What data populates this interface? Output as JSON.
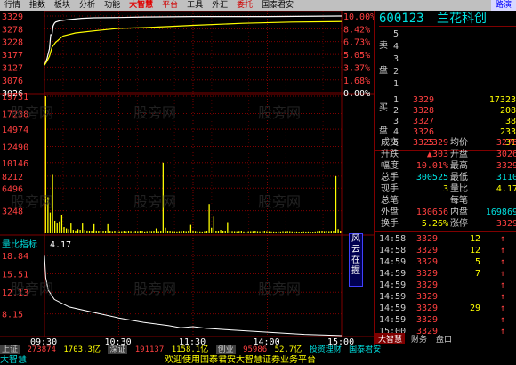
{
  "menu": {
    "items": [
      "行情",
      "指数",
      "板块",
      "分析",
      "功能",
      "大智慧",
      "平台",
      "工具",
      "外汇",
      "委托",
      "国泰君安"
    ],
    "right_button": "路演"
  },
  "chart_data": {
    "type": "line",
    "price_axis": {
      "ticks": [
        "3329",
        "3278",
        "3228",
        "3177",
        "3127",
        "3076",
        "3026"
      ],
      "prev_close": "3026",
      "ylim": [
        3026,
        3329
      ]
    },
    "pct_axis": {
      "ticks": [
        "10.00%",
        "8.42%",
        "6.73%",
        "5.05%",
        "3.37%",
        "1.68%",
        "0.00%"
      ]
    },
    "volume_axis": {
      "ticks": [
        "19731",
        "17238",
        "14974",
        "12490",
        "10146",
        "8212",
        "6496",
        "3248"
      ],
      "ylim": [
        0,
        19731
      ]
    },
    "time_axis": [
      "09:30",
      "10:30",
      "11:30",
      "14:00",
      "15:00"
    ],
    "price_series": [
      {
        "name": "price",
        "points": [
          [
            0,
            3135
          ],
          [
            2,
            3160
          ],
          [
            4,
            3200
          ],
          [
            5,
            3255
          ],
          [
            6,
            3255
          ],
          [
            7,
            3290
          ],
          [
            8,
            3300
          ],
          [
            9,
            3305
          ],
          [
            12,
            3310
          ],
          [
            15,
            3312
          ],
          [
            20,
            3315
          ],
          [
            30,
            3320
          ],
          [
            40,
            3322
          ],
          [
            60,
            3323
          ],
          [
            80,
            3325
          ],
          [
            100,
            3326
          ],
          [
            120,
            3327
          ],
          [
            180,
            3327
          ],
          [
            240,
            3329
          ]
        ]
      },
      {
        "name": "avg",
        "points": [
          [
            0,
            3135
          ],
          [
            2,
            3150
          ],
          [
            4,
            3170
          ],
          [
            6,
            3205
          ],
          [
            9,
            3225
          ],
          [
            15,
            3250
          ],
          [
            25,
            3262
          ],
          [
            40,
            3270
          ],
          [
            60,
            3280
          ],
          [
            80,
            3283
          ],
          [
            100,
            3287
          ],
          [
            120,
            3292
          ],
          [
            160,
            3300
          ],
          [
            200,
            3305
          ],
          [
            240,
            3307
          ]
        ]
      }
    ],
    "volume_bars": [
      19731,
      5200,
      3000,
      8400,
      1800,
      1400,
      1700,
      2600,
      900,
      700,
      600,
      1400,
      500,
      400,
      600,
      500,
      1400,
      500,
      400,
      350,
      300,
      1300,
      400,
      300,
      250,
      350,
      300,
      1300,
      250,
      200,
      300,
      200,
      180,
      200,
      250,
      200,
      300,
      220,
      180,
      240,
      200,
      260,
      300,
      150,
      200,
      280,
      220,
      300,
      700,
      200,
      250,
      10146,
      800,
      300,
      250,
      200,
      180,
      160,
      200,
      220,
      300,
      200,
      260,
      1200,
      300,
      220,
      180,
      160,
      140,
      200,
      260,
      4200,
      800,
      2400,
      300,
      250,
      500,
      300,
      350,
      1600,
      250,
      220,
      200,
      180,
      220,
      300,
      160,
      140,
      180,
      200,
      220,
      260,
      200,
      180,
      240,
      300,
      200,
      180,
      160,
      150,
      140,
      160,
      150,
      200,
      180,
      220,
      200,
      160,
      140,
      150,
      120,
      130,
      160,
      140,
      150,
      130,
      120,
      150,
      200,
      240,
      300,
      200,
      260,
      200,
      240,
      300,
      8212,
      600,
      300
    ],
    "indicator": {
      "name": "量比指标",
      "value": "4.17",
      "ticks": [
        "18.84",
        "15.51",
        "12.13",
        "8.15"
      ],
      "ylim": [
        4,
        20
      ],
      "points": [
        [
          0,
          18.8
        ],
        [
          1,
          14.8
        ],
        [
          3,
          12.5
        ],
        [
          8,
          10.8
        ],
        [
          20,
          9.4
        ],
        [
          40,
          8.4
        ],
        [
          60,
          7.4
        ],
        [
          80,
          6.6
        ],
        [
          100,
          6.0
        ],
        [
          110,
          5.6
        ],
        [
          120,
          5.8
        ],
        [
          130,
          5.5
        ],
        [
          150,
          5.2
        ],
        [
          180,
          4.8
        ],
        [
          210,
          4.4
        ],
        [
          240,
          4.17
        ]
      ]
    }
  },
  "sidepanel": {
    "code": "600123",
    "name": "兰花科创",
    "sell_label": "卖",
    "sell_disk": "盘",
    "buy_label": "买",
    "buy_disk": "盘",
    "sell_levels": [
      {
        "level": "5",
        "price": "",
        "qty": ""
      },
      {
        "level": "4",
        "price": "",
        "qty": ""
      },
      {
        "level": "3",
        "price": "",
        "qty": ""
      },
      {
        "level": "2",
        "price": "",
        "qty": ""
      },
      {
        "level": "1",
        "price": "",
        "qty": ""
      }
    ],
    "buy_levels": [
      {
        "level": "1",
        "price": "3329",
        "qty": "17323"
      },
      {
        "level": "2",
        "price": "3328",
        "qty": "208"
      },
      {
        "level": "3",
        "price": "3327",
        "qty": "38"
      },
      {
        "level": "4",
        "price": "3326",
        "qty": "233"
      },
      {
        "level": "5",
        "price": "3325",
        "qty": "31"
      }
    ],
    "stats": [
      {
        "k1": "成交",
        "v1": "3329",
        "k2": "均价",
        "v2": "3276"
      },
      {
        "k1": "升跌",
        "v1": "▲303",
        "k2": "开盘",
        "v2": "3026"
      },
      {
        "k1": "幅度",
        "v1": "10.01%",
        "k2": "最高",
        "v2": "3329"
      },
      {
        "k1": "总手",
        "v1": "300525",
        "k2": "最低",
        "v2": "3110"
      },
      {
        "k1": "现手",
        "v1": "3",
        "k2": "量比",
        "v2": "4.17"
      },
      {
        "k1": "总笔",
        "v1": "",
        "k2": "每笔",
        "v2": ""
      },
      {
        "k1": "外盘",
        "v1": "130656",
        "k2": "内盘",
        "v2": "169869"
      },
      {
        "k1": "换手",
        "v1": "5.26%",
        "k2": "涨停",
        "v2": "3329"
      }
    ],
    "ticks": [
      {
        "time": "14:58",
        "price": "3329",
        "vol": "12",
        "dir": "↑"
      },
      {
        "time": "14:58",
        "price": "3329",
        "vol": "12",
        "dir": "↑"
      },
      {
        "time": "14:59",
        "price": "3329",
        "vol": "5",
        "dir": "↑"
      },
      {
        "time": "14:59",
        "price": "3329",
        "vol": "7",
        "dir": "↑"
      },
      {
        "time": "14:59",
        "price": "3329",
        "vol": "",
        "dir": "↑"
      },
      {
        "time": "14:59",
        "price": "3329",
        "vol": "",
        "dir": "↑"
      },
      {
        "time": "14:59",
        "price": "3329",
        "vol": "29",
        "dir": "↑"
      },
      {
        "time": "14:59",
        "price": "3329",
        "vol": "",
        "dir": "↑"
      },
      {
        "time": "15:00",
        "price": "3329",
        "vol": "",
        "dir": "↑"
      }
    ],
    "tabs": [
      "大智慧",
      "财务",
      "盘口"
    ]
  },
  "status": {
    "sh_label": "上证",
    "sh_value": "273874",
    "sh_amount": "1703.3亿",
    "sz_label": "深证",
    "sz_value": "191137",
    "sz_amount": "1158.1亿",
    "cy_label": "创业",
    "cy_value": "95986",
    "cy_amount": "52.7亿",
    "link1": "投资理财",
    "link2": "国泰君安"
  },
  "ticker": {
    "tag": "大智慧",
    "message": "欢迎使用国泰君安大智慧证券业务平台"
  },
  "colors": {
    "up": "#ff4040",
    "down": "#00ff00",
    "price_line": "#ffffff",
    "avg_line": "#ffff00",
    "volume": "#ffff00",
    "grid": "#800000",
    "axis_label": "#ff4040",
    "prev_close": "#ffffff"
  }
}
